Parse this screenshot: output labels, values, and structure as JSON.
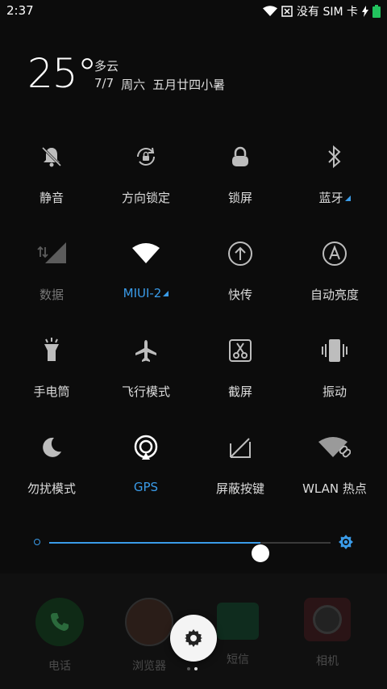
{
  "status_bar": {
    "time": "2:37",
    "no_sim_text": "没有 SIM 卡"
  },
  "weather": {
    "temperature": "25°",
    "condition": "多云",
    "date": "7/7",
    "weekday": "周六",
    "lunar": "五月廿四小暑"
  },
  "tiles": [
    {
      "label": "静音",
      "icon": "bell-off-icon"
    },
    {
      "label": "方向锁定",
      "icon": "rotation-lock-icon"
    },
    {
      "label": "锁屏",
      "icon": "lock-icon"
    },
    {
      "label": "蓝牙",
      "icon": "bluetooth-icon"
    },
    {
      "label": "数据",
      "icon": "mobile-data-icon"
    },
    {
      "label": "MIUI-2",
      "icon": "wifi-icon"
    },
    {
      "label": "快传",
      "icon": "upload-icon"
    },
    {
      "label": "自动亮度",
      "icon": "auto-brightness-icon"
    },
    {
      "label": "手电筒",
      "icon": "flashlight-icon"
    },
    {
      "label": "飞行模式",
      "icon": "airplane-icon"
    },
    {
      "label": "截屏",
      "icon": "screenshot-icon"
    },
    {
      "label": "振动",
      "icon": "vibrate-icon"
    },
    {
      "label": "勿扰模式",
      "icon": "moon-icon"
    },
    {
      "label": "GPS",
      "icon": "gps-icon"
    },
    {
      "label": "屏蔽按键",
      "icon": "keys-off-icon"
    },
    {
      "label": "WLAN 热点",
      "icon": "hotspot-icon"
    }
  ],
  "brightness": {
    "level": 0.75
  },
  "dock": [
    {
      "label": "电话",
      "icon": "phone-icon"
    },
    {
      "label": "浏览器",
      "icon": "browser-icon"
    },
    {
      "label": "短信",
      "icon": "message-icon"
    },
    {
      "label": "相机",
      "icon": "camera-icon"
    }
  ],
  "colors": {
    "accent": "#3a9be8",
    "background": "#0c0c0c"
  }
}
